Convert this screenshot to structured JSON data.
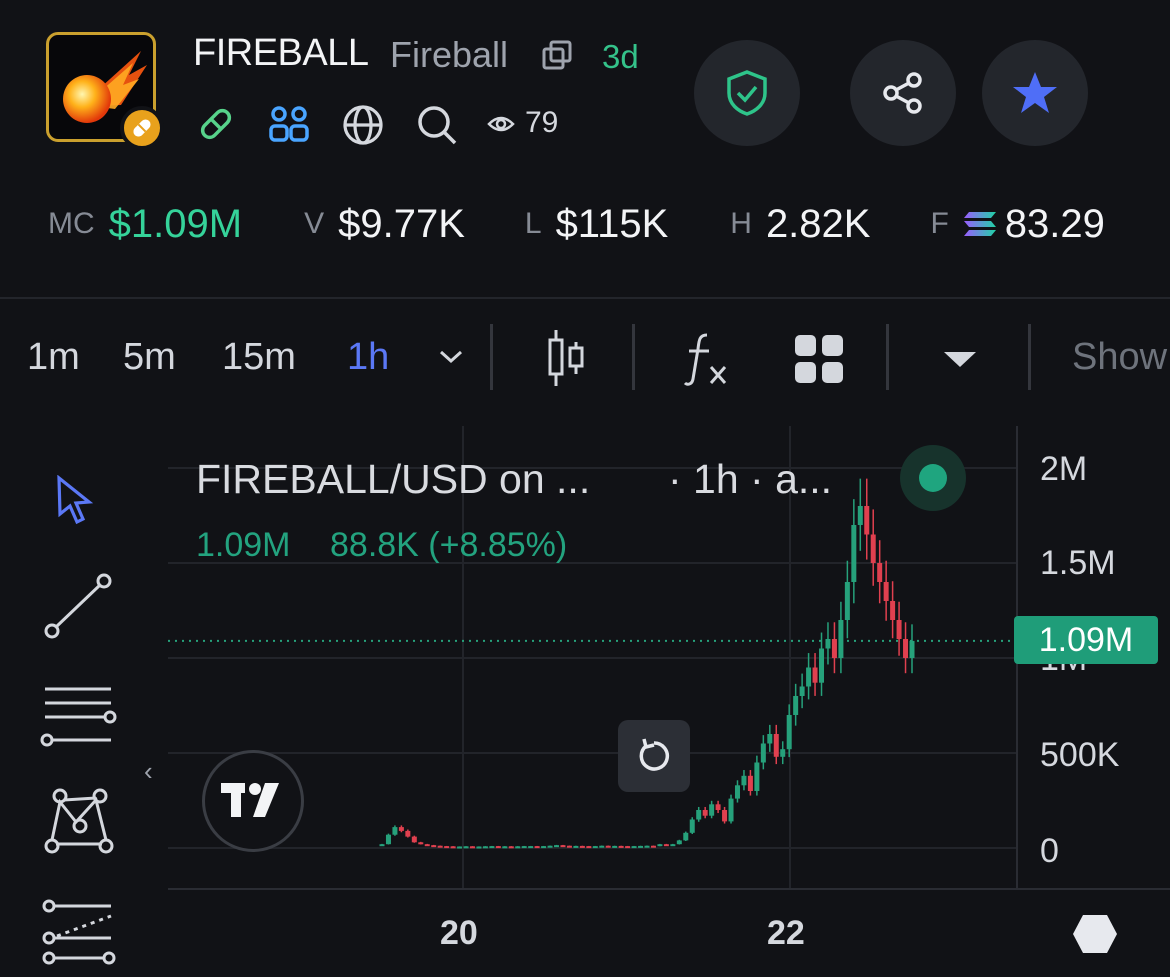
{
  "header": {
    "symbol": "FIREBALL",
    "name": "Fireball",
    "age": "3d",
    "watchers": "79",
    "icons": [
      "pill-link-icon",
      "users-icon",
      "globe-icon",
      "search-icon",
      "eye-icon",
      "copy-icon"
    ]
  },
  "actions": {
    "security": "shield-check-icon",
    "share": "share-icon",
    "favorite": "star-icon"
  },
  "stats": [
    {
      "label": "MC",
      "value": "$1.09M",
      "color": "#35d39a"
    },
    {
      "label": "V",
      "value": "$9.77K",
      "color": "#f3f4f6"
    },
    {
      "label": "L",
      "value": "$115K",
      "color": "#f3f4f6"
    },
    {
      "label": "H",
      "value": "2.82K",
      "color": "#f3f4f6"
    },
    {
      "label": "F",
      "value": "83.29",
      "color": "#f3f4f6"
    }
  ],
  "toolbar": {
    "timeframes": [
      "1m",
      "5m",
      "15m",
      "1h"
    ],
    "active_timeframe": "1h",
    "show_label": "Show"
  },
  "chart": {
    "legend_title": "FIREBALL/USD on ...",
    "legend_meta": "· 1h · a...",
    "legend_value": "1.09M",
    "legend_change": "88.8K (+8.85%)",
    "current_price_label": "1.09M",
    "colors": {
      "up": "#26a17b",
      "down": "#e0404f",
      "accent": "#4f6ef7"
    }
  },
  "chart_data": {
    "type": "candlestick",
    "y_ticks": [
      "2M",
      "1.5M",
      "1M",
      "500K",
      "0"
    ],
    "x_ticks": [
      "20",
      "22"
    ],
    "ylim": [
      0,
      2000000
    ],
    "current_price": 1090000,
    "series": [
      {
        "name": "",
        "values": [
          20000,
          70000,
          110000,
          90000,
          60000,
          30000,
          20000,
          15000,
          12000,
          10000,
          9000,
          8000,
          8000,
          9000,
          8000,
          8000,
          9000,
          10000,
          8000,
          9000,
          8000,
          9000,
          10000,
          10000,
          9000,
          10000,
          12000,
          15000,
          12000,
          10000,
          11000,
          10000,
          9000,
          10000,
          12000,
          10000,
          11000,
          10000,
          9000,
          10000,
          11000,
          12000,
          10000,
          20000,
          15000,
          20000,
          40000,
          80000,
          150000,
          200000,
          170000,
          230000,
          200000,
          140000,
          260000,
          330000,
          380000,
          300000,
          450000,
          550000,
          600000,
          480000,
          520000,
          700000,
          800000,
          850000,
          950000,
          870000,
          1050000,
          1100000,
          1000000,
          1200000,
          1400000,
          1700000,
          1800000,
          1650000,
          1500000,
          1400000,
          1300000,
          1200000,
          1100000,
          1000000,
          1090000
        ]
      }
    ]
  }
}
